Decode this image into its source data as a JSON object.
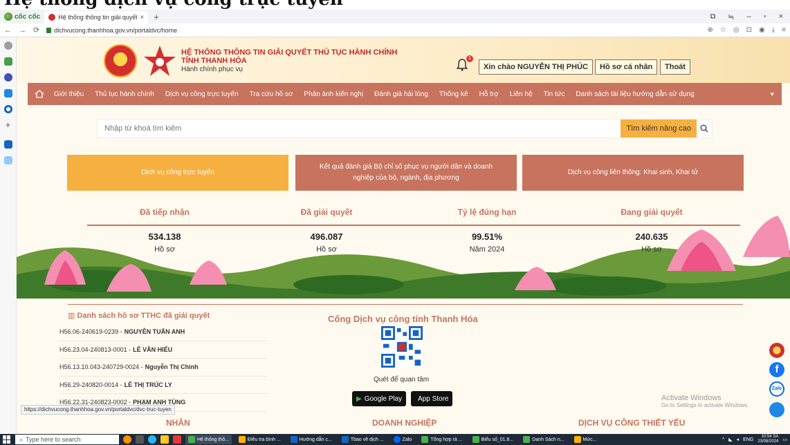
{
  "overlay_heading": "Hệ thống dịch vụ công trực tuyến",
  "browser": {
    "name": "cốc cốc",
    "tab_title": "Hệ thống thông tin giải quyết",
    "url": "dichvucong.thanhhoa.gov.vn/portaldvc/home",
    "status_url": "https://dichvucong.thanhhoa.gov.vn/portaldvc/dvc-truc-tuyen"
  },
  "header": {
    "title_line1": "HỆ THỐNG THÔNG TIN GIẢI QUYẾT THỦ TỤC HÀNH CHÍNH",
    "title_line2": "TỈNH THANH HÓA",
    "subtitle": "Hành chính phục vụ",
    "notification_count": "1",
    "greeting": "Xin chào NGUYỄN THỊ PHÚC",
    "profile_btn": "Hồ sơ cá nhân",
    "logout_btn": "Thoát"
  },
  "nav": [
    "Giới thiệu",
    "Thủ tục hành chính",
    "Dịch vụ công trực tuyến",
    "Tra cứu hồ sơ",
    "Phản ánh kiến nghị",
    "Đánh giá hài lòng",
    "Thống kê",
    "Hỗ trợ",
    "Liên hệ",
    "Tin tức",
    "Danh sách tài liệu hướng dẫn sử dụng"
  ],
  "search": {
    "placeholder": "Nhập từ khoá tìm kiếm",
    "advanced": "Tìm kiếm nâng cao"
  },
  "big_buttons": [
    "Dịch vụ công trực tuyến",
    "Kết quả đánh giá Bộ chỉ số phục vụ người dân và doanh nghiệp của bộ, ngành, địa phương",
    "Dịch vụ công liên thông: Khai sinh, Khai tử"
  ],
  "stats": [
    {
      "label": "Đã tiếp nhận",
      "value": "534.138",
      "unit": "Hồ sơ"
    },
    {
      "label": "Đã giải quyết",
      "value": "496.087",
      "unit": "Hồ sơ"
    },
    {
      "label": "Tỷ lệ đúng hạn",
      "value": "99.51%",
      "unit": "Năm 2024"
    },
    {
      "label": "Đang giải quyết",
      "value": "240.635",
      "unit": "Hồ sơ"
    }
  ],
  "resolved_list": {
    "title": "Danh sách hồ sơ TTHC đã giải quyết",
    "items": [
      {
        "code": "H56.06-240619-0239 -",
        "name": "NGUYỄN TUẤN ANH"
      },
      {
        "code": "H56.23.04-240813-0001 -",
        "name": "LÊ VĂN HIẾU"
      },
      {
        "code": "H56.13.10.043-240729-0024 -",
        "name": "Nguyễn Thị Chinh"
      },
      {
        "code": "H56.29-240820-0014 -",
        "name": "LÊ THỊ TRÚC LY"
      },
      {
        "code": "H56.22.31-240823-0002 -",
        "name": "PHẠM ANH TÙNG"
      }
    ]
  },
  "portal": {
    "title": "Cổng Dịch vụ công tỉnh Thanh Hóa",
    "qr_caption": "Quét để quan tâm",
    "google_play": "Google Play",
    "app_store": "App Store"
  },
  "sections": {
    "personal": "NHÂN",
    "business": "DOANH NGHIỆP",
    "essential": "DỊCH VỤ CÔNG THIẾT YẾU"
  },
  "activate": {
    "line1": "Activate Windows",
    "line2": "Go to Settings to activate Windows."
  },
  "taskbar": {
    "search": "Type here to search",
    "tasks": [
      "Hệ thống thô...",
      "Điều tra bình ...",
      "Hướng dẫn c...",
      "Tbao về dịch ...",
      "Zalo",
      "Tổng hợp rà ...",
      "Biểu số_01.8...",
      "Danh Sách n...",
      "Mức..."
    ],
    "lang": "ENG",
    "time": "10:54 SA",
    "date": "23/08/2024"
  },
  "colors": {
    "accent": "#c7735e",
    "yellow_button": "#f6b040",
    "title_red": "#c62828"
  }
}
